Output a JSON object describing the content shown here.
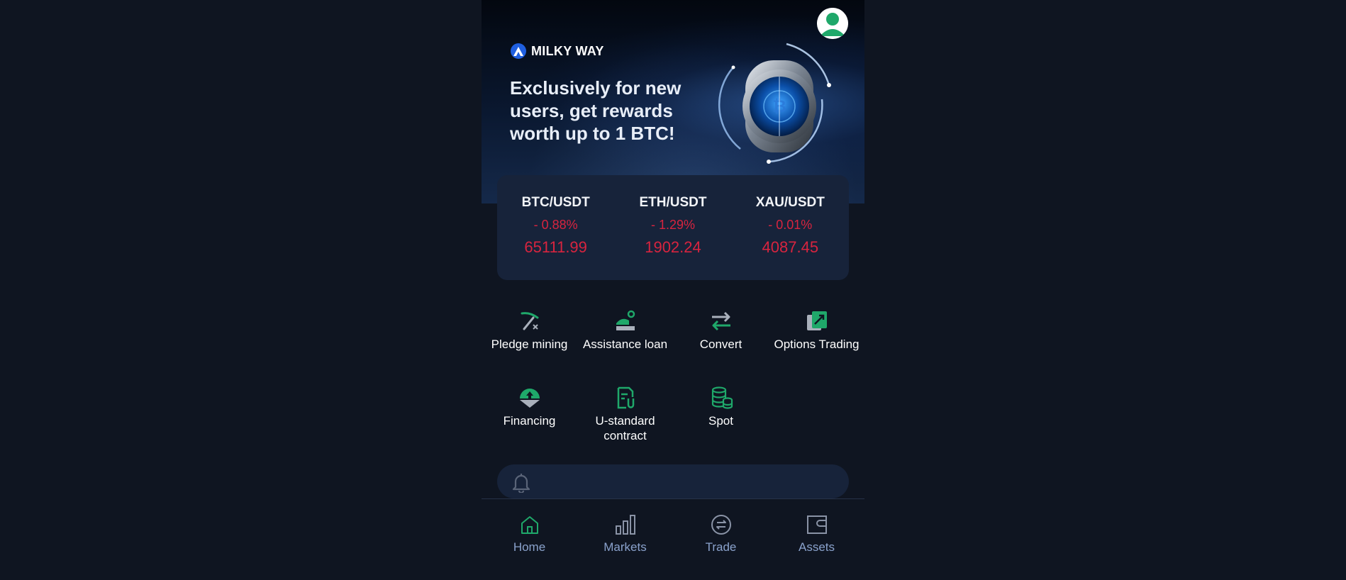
{
  "banner": {
    "brand": "MILKY WAY",
    "headline": "Exclusively for new users, get rewards worth up to 1 BTC!"
  },
  "tickers": [
    {
      "pair": "BTC/USDT",
      "change": "- 0.88%",
      "price": "65111.99"
    },
    {
      "pair": "ETH/USDT",
      "change": "- 1.29%",
      "price": "1902.24"
    },
    {
      "pair": "XAU/USDT",
      "change": "- 0.01%",
      "price": "4087.45"
    }
  ],
  "features": [
    {
      "label": "Pledge mining",
      "icon": "pickaxe-icon"
    },
    {
      "label": "Assistance loan",
      "icon": "loan-icon"
    },
    {
      "label": "Convert",
      "icon": "convert-arrows-icon"
    },
    {
      "label": "Options Trading",
      "icon": "options-chart-icon"
    },
    {
      "label": "Financing",
      "icon": "financing-icon"
    },
    {
      "label": "U-standard contract",
      "icon": "contract-icon"
    },
    {
      "label": "Spot",
      "icon": "coins-stack-icon"
    }
  ],
  "notice": {
    "icon": "bell-icon"
  },
  "nav": [
    {
      "label": "Home",
      "icon": "home-icon",
      "active": true
    },
    {
      "label": "Markets",
      "icon": "bar-chart-icon",
      "active": false
    },
    {
      "label": "Trade",
      "icon": "exchange-circle-icon",
      "active": false
    },
    {
      "label": "Assets",
      "icon": "wallet-icon",
      "active": false
    }
  ],
  "colors": {
    "background": "#0f1521",
    "card": "#17233a",
    "negative": "#d8243f",
    "accent_green": "#1fa86a",
    "nav_label": "#8aa2cc",
    "nav_icon_inactive": "#8a93a6"
  }
}
